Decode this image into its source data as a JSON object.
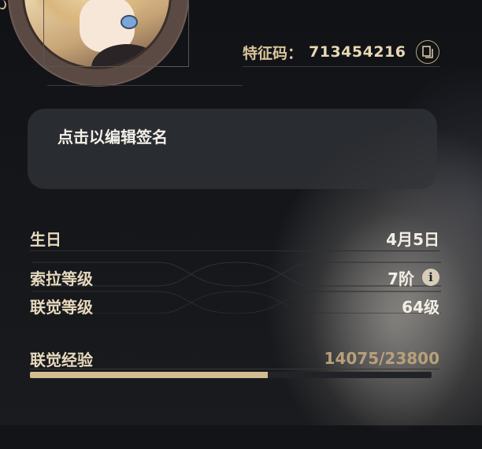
{
  "profile": {
    "id_label": "特征码：",
    "id_value": "713454216",
    "copy_icon": "copy-icon"
  },
  "signature": {
    "placeholder": "点击以编辑签名"
  },
  "info": {
    "birthday_label": "生日",
    "birthday_value": "4月5日",
    "sola_label": "索拉等级",
    "sola_value": "7阶",
    "sola_info_icon": "i",
    "link_label": "联觉等级",
    "link_value": "64级"
  },
  "xp": {
    "label": "联觉经验",
    "value": "14075/23800",
    "progress": 0.5914
  },
  "colors": {
    "accent": "#d4bc91",
    "label": "#e7d9bd",
    "xp_value": "#b8a07c"
  }
}
